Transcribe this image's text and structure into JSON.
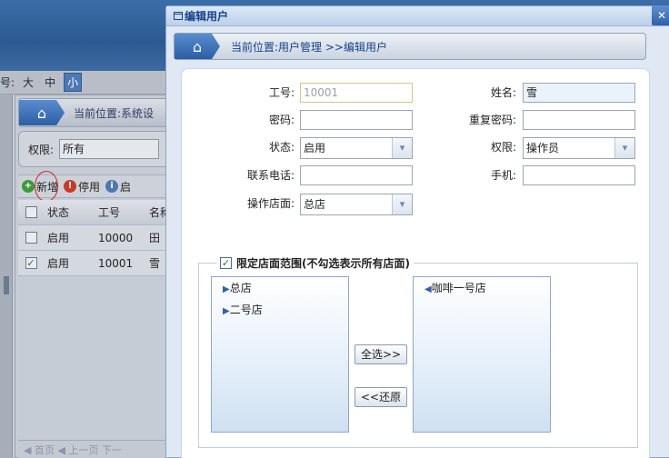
{
  "bg": {
    "size_label": "号:",
    "sizes": [
      "大",
      "中",
      "小"
    ],
    "location": "当前位置:系统设",
    "filter_label": "权限:",
    "filter_value": "所有",
    "toolbar": {
      "add": "新增",
      "stop": "停用",
      "other": "启"
    },
    "grid": {
      "headers": [
        "状态",
        "工号",
        "名称"
      ],
      "rows": [
        {
          "checked": false,
          "status": "启用",
          "id": "10000",
          "name": "田"
        },
        {
          "checked": true,
          "status": "启用",
          "id": "10001",
          "name": "雪"
        }
      ]
    },
    "pager": "◀ 首页 ◀ 上一页 下一"
  },
  "dialog": {
    "title": "编辑用户",
    "close": "✕",
    "location": "当前位置:用户管理 >>编辑用户",
    "fields": {
      "emp_no_label": "工号:",
      "emp_no": "10001",
      "name_label": "姓名:",
      "name": "雪",
      "password_label": "密码:",
      "password": "",
      "repeat_password_label": "重复密码:",
      "repeat_password": "",
      "status_label": "状态:",
      "status": "启用",
      "role_label": "权限:",
      "role": "操作员",
      "phone_label": "联系电话:",
      "phone": "",
      "mobile_label": "手机:",
      "mobile": "",
      "store_label": "操作店面:",
      "store": "总店"
    },
    "scope": {
      "legend": "限定店面范围(不勾选表示所有店面)",
      "checked": true,
      "available": [
        "总店",
        "二号店"
      ],
      "selected": [
        "咖啡一号店"
      ],
      "select_all": "全选>>",
      "restore": "<<还原"
    }
  }
}
